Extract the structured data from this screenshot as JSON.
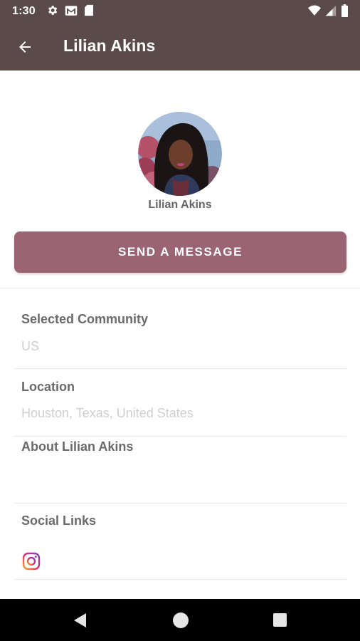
{
  "status_bar": {
    "time": "1:30",
    "icons": [
      "settings-icon",
      "gmail-icon",
      "sd-card-icon",
      "wifi-icon",
      "signal-icon",
      "battery-icon"
    ]
  },
  "app_bar": {
    "title": "Lilian Akins",
    "back_icon": "arrow-back-icon"
  },
  "profile": {
    "name": "Lilian Akins",
    "send_button_label": "SEND A MESSAGE"
  },
  "sections": {
    "community": {
      "label": "Selected Community",
      "value": "US"
    },
    "location": {
      "label": "Location",
      "value": "Houston, Texas, United States"
    },
    "about": {
      "label": "About Lilian Akins"
    },
    "social": {
      "label": "Social Links",
      "links": [
        "instagram-icon"
      ]
    }
  },
  "colors": {
    "app_bar": "#5a4a4a",
    "accent_button": "#9b6474",
    "label_text": "#6a6a6a",
    "value_text": "#cfcfcf"
  },
  "nav_bar": {
    "buttons": [
      "back-triangle-icon",
      "home-circle-icon",
      "recents-square-icon"
    ]
  }
}
